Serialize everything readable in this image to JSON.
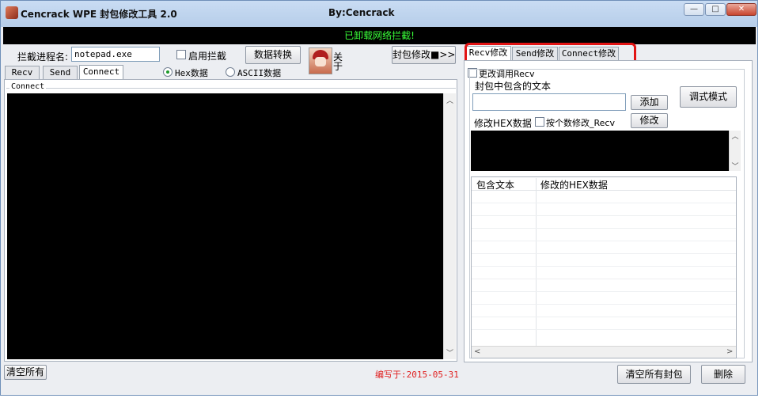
{
  "window": {
    "title": "Cencrack WPE 封包修改工具 2.0",
    "author": "By:Cencrack",
    "controls": {
      "minimize": "—",
      "maximize": "□",
      "close": "✕"
    }
  },
  "status": {
    "text": "已卸载网络拦截!",
    "color": "#39ff39"
  },
  "left_panel": {
    "process_label": "拦截进程名:",
    "process_value": "notepad.exe",
    "enable_intercept_label": "启用拦截",
    "convert_button": "数据转换",
    "about_label": "关于",
    "packet_modify_button": "封包修改■>>",
    "tabs": [
      "Recv",
      "Send",
      "Connect"
    ],
    "active_tab": "Connect",
    "radio_hex": "Hex数据",
    "radio_ascii": "ASCII数据",
    "group_label": "Connect",
    "clear_all_button": "清空所有",
    "written_date": "编写于:2015-05-31"
  },
  "right_panel": {
    "tabs": [
      "Recv修改",
      "Send修改",
      "Connect修改"
    ],
    "active_tab": "Recv修改",
    "change_call_label": "更改调用Recv",
    "contains_text_label": "封包中包含的文本",
    "add_button": "添加",
    "debug_mode_button": "调式模式",
    "modify_hex_label": "修改HEX数据",
    "per_count_label": "按个数修改_Recv",
    "modify_button": "修改",
    "table_columns": [
      "包含文本",
      "修改的HEX数据"
    ],
    "clear_packets_button": "清空所有封包",
    "delete_button": "删除"
  },
  "colors": {
    "highlight": "#e21414",
    "date_text": "#e02020",
    "terminal_bg": "#000000"
  }
}
